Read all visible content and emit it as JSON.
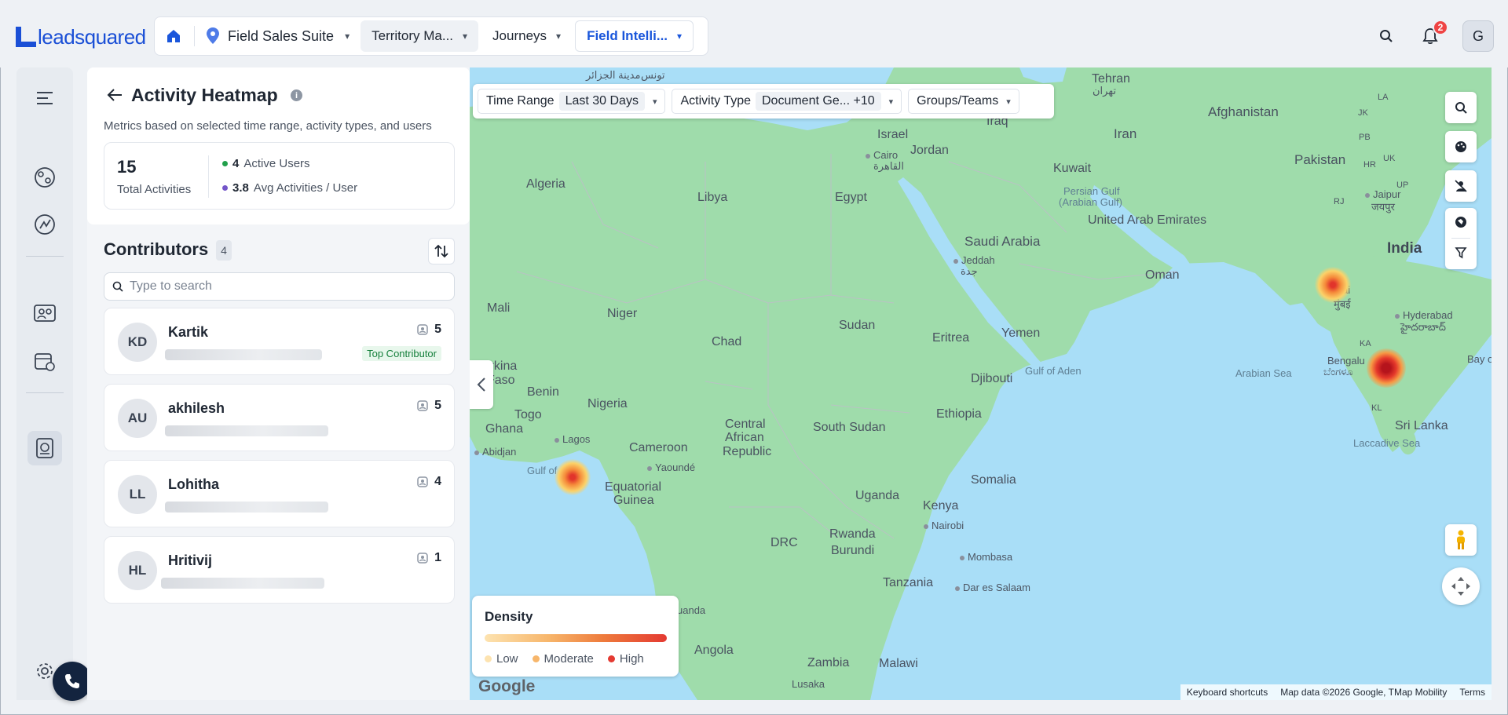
{
  "app": {
    "logo_text": "leadsquared",
    "suite_label": "Field Sales Suite",
    "tabs": [
      {
        "label": "Territory Ma..."
      },
      {
        "label": "Journeys"
      },
      {
        "label": "Field Intelli..."
      }
    ],
    "notification_count": "2",
    "user_initial": "G"
  },
  "panel": {
    "title": "Activity Heatmap",
    "info_glyph": "i",
    "description": "Metrics based on selected time range, activity types, and users",
    "total_activities_value": "15",
    "total_activities_label": "Total Activities",
    "active_users_value": "4",
    "active_users_label": "Active Users",
    "avg_value": "3.8",
    "avg_label": "Avg Activities / User",
    "contributors_title": "Contributors",
    "contributors_count": "4",
    "search_placeholder": "Type to search",
    "contributors": [
      {
        "initials": "KD",
        "name": "Kartik",
        "count": "5",
        "tag": "Top Contributor"
      },
      {
        "initials": "AU",
        "name": "akhilesh",
        "count": "5",
        "tag": ""
      },
      {
        "initials": "LL",
        "name": "Lohitha",
        "count": "4",
        "tag": ""
      },
      {
        "initials": "HL",
        "name": "Hritivij",
        "count": "1",
        "tag": ""
      }
    ]
  },
  "filters": {
    "time_range_label": "Time Range",
    "time_range_value": "Last 30 Days",
    "activity_type_label": "Activity Type",
    "activity_type_value": "Document Ge...",
    "activity_type_extra": "+10",
    "groups_label": "Groups/Teams"
  },
  "legend": {
    "title": "Density",
    "low": "Low",
    "moderate": "Moderate",
    "high": "High",
    "colors": {
      "low": "#fde3b0",
      "moderate": "#f7b66b",
      "high": "#e43a32"
    }
  },
  "map": {
    "labels": {
      "tehran": "Tehran",
      "tehran_local": "تهران",
      "afghanistan": "Afghanistan",
      "iraq": "Iraq",
      "iran": "Iran",
      "israel": "Israel",
      "jordan": "Jordan",
      "cairo": "Cairo",
      "cairo_local": "القاهرة",
      "pakistan": "Pakistan",
      "kuwait": "Kuwait",
      "persian_gulf": "Persian Gulf",
      "arabian_gulf": "(Arabian Gulf)",
      "jaipur": "Jaipur",
      "jaipur_local": "जयपुर",
      "algeria": "Algeria",
      "libya": "Libya",
      "egypt": "Egypt",
      "saudi": "Saudi Arabia",
      "jeddah": "Jeddah",
      "jeddah_local": "جدة",
      "uae": "United Arab Emirates",
      "oman": "Oman",
      "india": "India",
      "mumbai": "mbai",
      "mumbai_local": "मुंबई",
      "hyderabad": "Hyderabad",
      "hyderabad_local": "హైదరాబాద్",
      "mali": "Mali",
      "niger": "Niger",
      "chad": "Chad",
      "sudan": "Sudan",
      "eritrea": "Eritrea",
      "yemen": "Yemen",
      "gulf_aden": "Gulf of Aden",
      "arabian_sea": "Arabian Sea",
      "bengaluru": "Bengalu",
      "bengaluru_local": "ಬೆಂಗಳೂ",
      "bay": "Bay o",
      "burkina": "Burkina",
      "faso": "Faso",
      "benin": "Benin",
      "nigeria": "Nigeria",
      "djibouti": "Djibouti",
      "togo": "Togo",
      "ghana": "Ghana",
      "lagos": "Lagos",
      "abidjan": "Abidjan",
      "car1": "Central",
      "car2": "African",
      "car3": "Republic",
      "south_sudan": "South Sudan",
      "ethiopia": "Ethiopia",
      "sri_lanka": "Sri Lanka",
      "laccadive": "Laccadive Sea",
      "cameroon": "Cameroon",
      "yaounde": "Yaoundé",
      "gulf_guinea": "Gulf of",
      "gulf_guinea2": "inea",
      "eq1": "Equatorial",
      "eq2": "Guinea",
      "somalia": "Somalia",
      "uganda": "Uganda",
      "kenya": "Kenya",
      "nairobi": "Nairobi",
      "rwanda": "Rwanda",
      "burundi": "Burundi",
      "drc": "DRC",
      "mombasa": "Mombasa",
      "tanzania": "Tanzania",
      "dar": "Dar es Salaam",
      "luanda": "uanda",
      "angola": "Angola",
      "zambia": "Zambia",
      "malawi": "Malawi",
      "lusaka": "Lusaka",
      "medina_local": "مدينة الجزائر",
      "tunis_local": "تونس",
      "la": "LA",
      "jk": "JK",
      "pb": "PB",
      "uk": "UK",
      "hr": "HR",
      "up": "UP",
      "rj": "RJ",
      "ka": "KA",
      "kl": "KL"
    },
    "google": "Google",
    "attribution": {
      "shortcuts": "Keyboard shortcuts",
      "data": "Map data ©2026 Google, TMap Mobility",
      "terms": "Terms"
    }
  }
}
